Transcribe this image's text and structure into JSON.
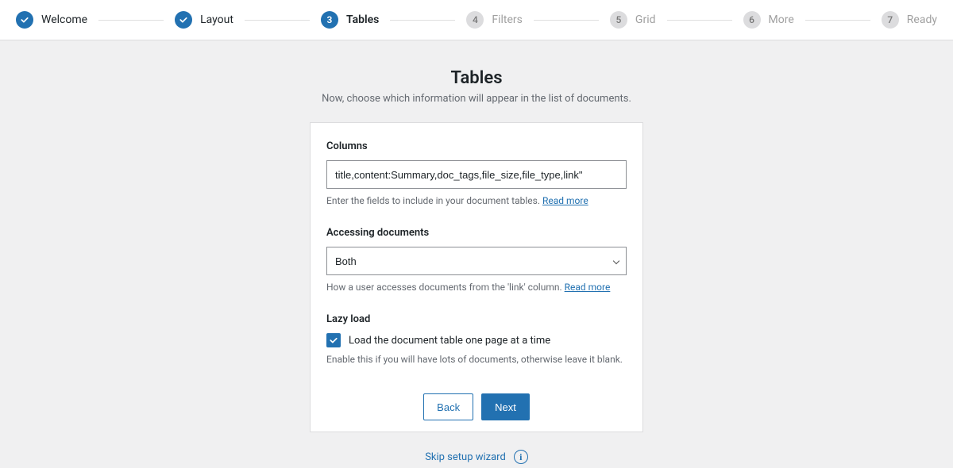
{
  "stepper": {
    "steps": [
      {
        "label": "Welcome",
        "state": "done",
        "num": "1"
      },
      {
        "label": "Layout",
        "state": "done",
        "num": "2"
      },
      {
        "label": "Tables",
        "state": "active",
        "num": "3"
      },
      {
        "label": "Filters",
        "state": "pending",
        "num": "4"
      },
      {
        "label": "Grid",
        "state": "pending",
        "num": "5"
      },
      {
        "label": "More",
        "state": "pending",
        "num": "6"
      },
      {
        "label": "Ready",
        "state": "pending",
        "num": "7"
      }
    ]
  },
  "page": {
    "title": "Tables",
    "subtitle": "Now, choose which information will appear in the list of documents."
  },
  "columns": {
    "label": "Columns",
    "value": "title,content:Summary,doc_tags,file_size,file_type,link\"",
    "help_text": "Enter the fields to include in your document tables. ",
    "help_link": "Read more"
  },
  "accessing": {
    "label": "Accessing documents",
    "selected": "Both",
    "help_text": "How a user accesses documents from the 'link' column. ",
    "help_link": "Read more"
  },
  "lazy": {
    "label": "Lazy load",
    "checked": true,
    "checkbox_label": "Load the document table one page at a time",
    "help_text": "Enable this if you will have lots of documents, otherwise leave it blank."
  },
  "buttons": {
    "back": "Back",
    "next": "Next"
  },
  "skip": {
    "label": "Skip setup wizard"
  }
}
